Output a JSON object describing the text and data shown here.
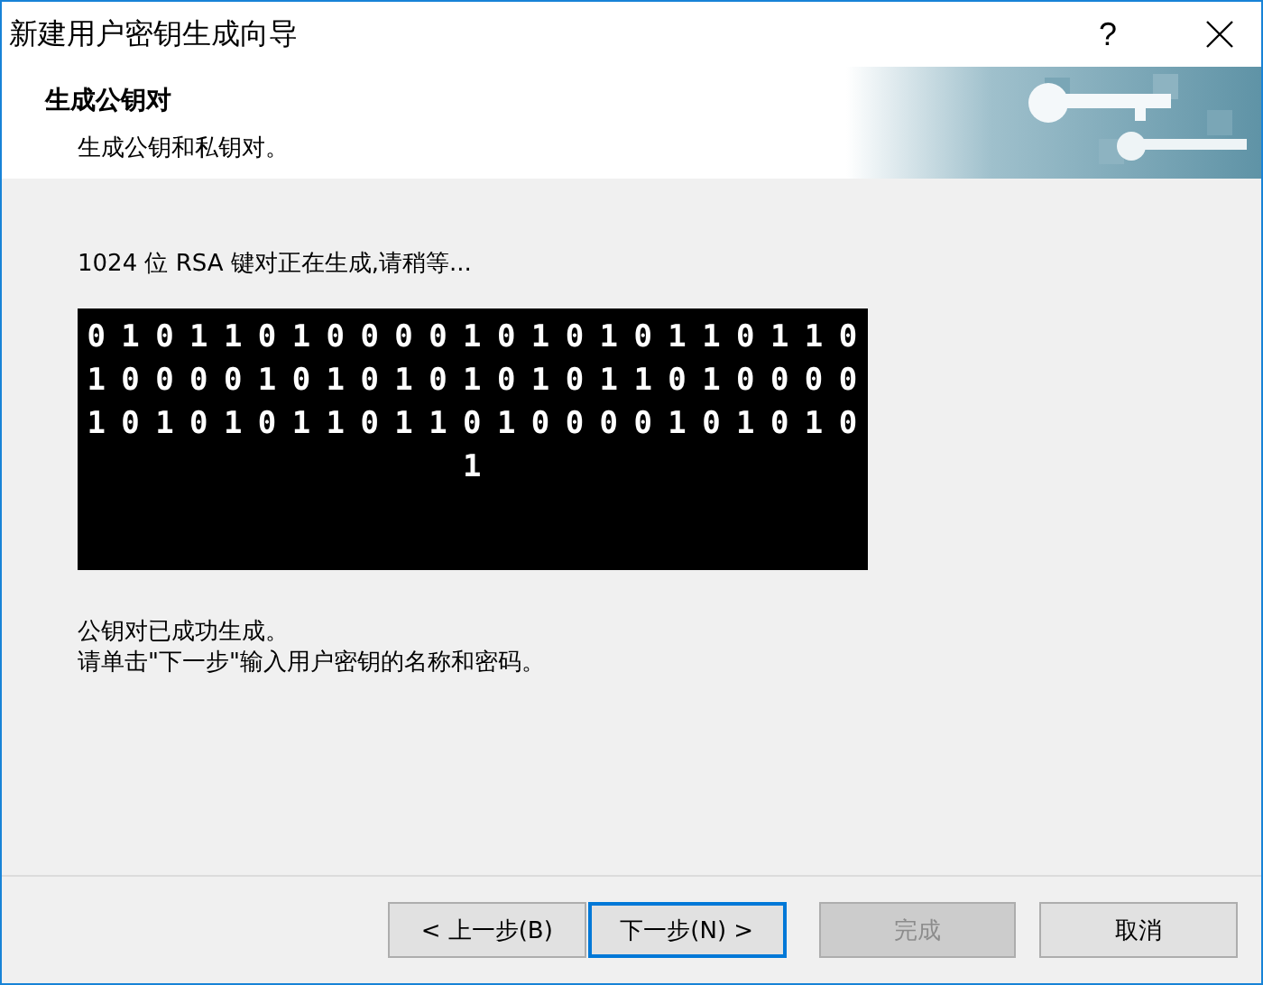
{
  "window": {
    "title": "新建用户密钥生成向导",
    "help": "?"
  },
  "header": {
    "title": "生成公钥对",
    "subtitle": "生成公钥和私钥对。",
    "kind": "picture"
  },
  "status": "1024 位 RSA 键对正在生成,请稍等...",
  "console_lines": [
    "01011010000101010110110",
    "10000101010101011010000",
    "10101011011010000101010",
    "1"
  ],
  "messages": [
    "公钥对已成功生成。",
    "请单击\"下一步\"输入用户密钥的名称和密码。"
  ],
  "buttons": [
    {
      "label": "< 上一步(B)",
      "disabled": false,
      "default": false
    },
    {
      "label": "下一步(N) >",
      "disabled": false,
      "default": true
    },
    {
      "label": "完成",
      "disabled": true,
      "default": false
    },
    {
      "label": "取消",
      "disabled": false,
      "default": false
    }
  ]
}
